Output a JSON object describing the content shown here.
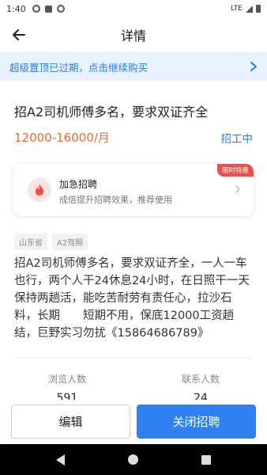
{
  "status_bar": {
    "time": "1:40",
    "network": "LTE"
  },
  "header": {
    "title": "详情"
  },
  "banner": {
    "text": "超级置顶已过期，点击继续购买"
  },
  "job": {
    "title": "招A2司机师傅多名，要求双证齐全",
    "salary": "12000-16000/月",
    "status": "招工中"
  },
  "urgent": {
    "title": "加急招聘",
    "description": "成倍提升招聘效果，推荐使用",
    "badge": "限时特惠"
  },
  "tags": [
    "山东省",
    "A2驾照"
  ],
  "description": "招A2司机师傅多名，要求双证齐全，一人一车也行，两个人干24休息24小时，在日照干一天保持两趟活，能吃苦耐劳有责任心，拉沙石料，长期　　短期不用，保底12000工资趟结，巨野实习勿扰《15864686789》",
  "stats": {
    "views_label": "浏览人数",
    "views_value": "591",
    "contacts_label": "联系人数",
    "contacts_value": "24"
  },
  "actions": {
    "edit_label": "编辑",
    "close_label": "关闭招聘"
  },
  "colors": {
    "accent": "#2b7be5",
    "salary": "#ef6a2e",
    "badge": "#f04d4d",
    "primary_button": "#2f80f0"
  },
  "icons": {
    "back": "back-arrow-icon",
    "banner_chevron": "chevron-right-icon",
    "urgent": "fire-icon"
  }
}
